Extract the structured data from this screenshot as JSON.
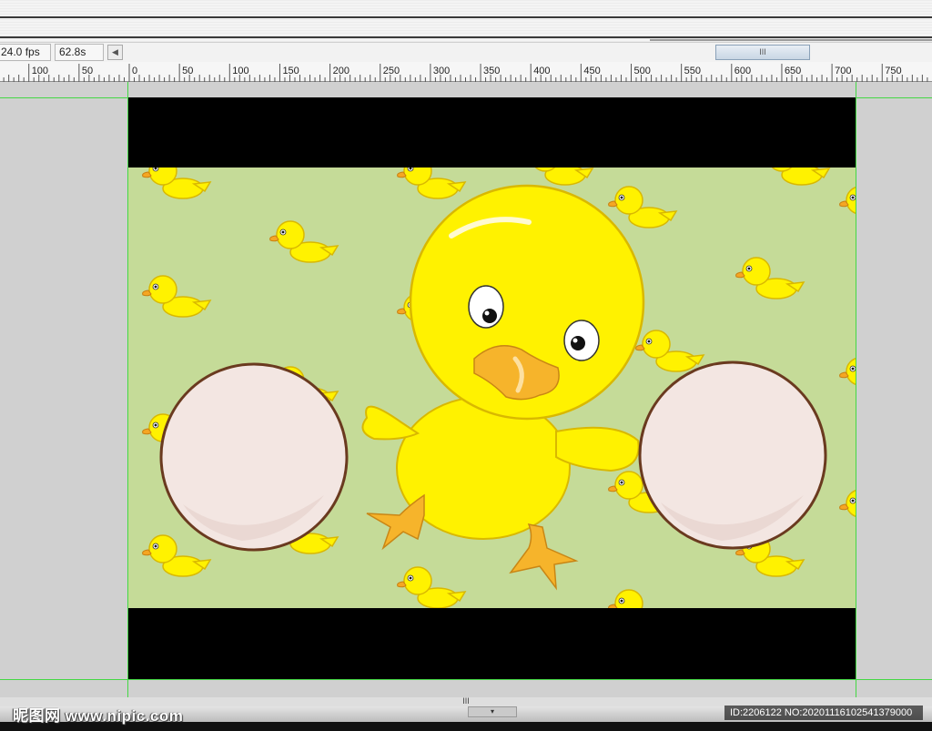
{
  "timeline": {
    "fps_label": "24.0 fps",
    "time_label": "62.8s",
    "scroll_left_glyph": "◀",
    "hscroll_grip": "III"
  },
  "ruler": {
    "labels": [
      "100",
      "50",
      "0",
      "50",
      "100",
      "150",
      "200",
      "250",
      "300",
      "350",
      "400",
      "450",
      "500",
      "550",
      "600",
      "650",
      "700",
      "750"
    ]
  },
  "stage": {
    "background_color": "#000000",
    "scene_color": "#c5db98",
    "duck_color": "#ffef00",
    "egg_color": "#f3e6e2",
    "egg_outline_color": "#6a3a1f"
  },
  "bottom": {
    "grip": "III",
    "tab_glyph": "▾",
    "watermark": "昵图网 www.nipic.com",
    "id_text": "ID:2206122 NO:20201116102541379000"
  }
}
